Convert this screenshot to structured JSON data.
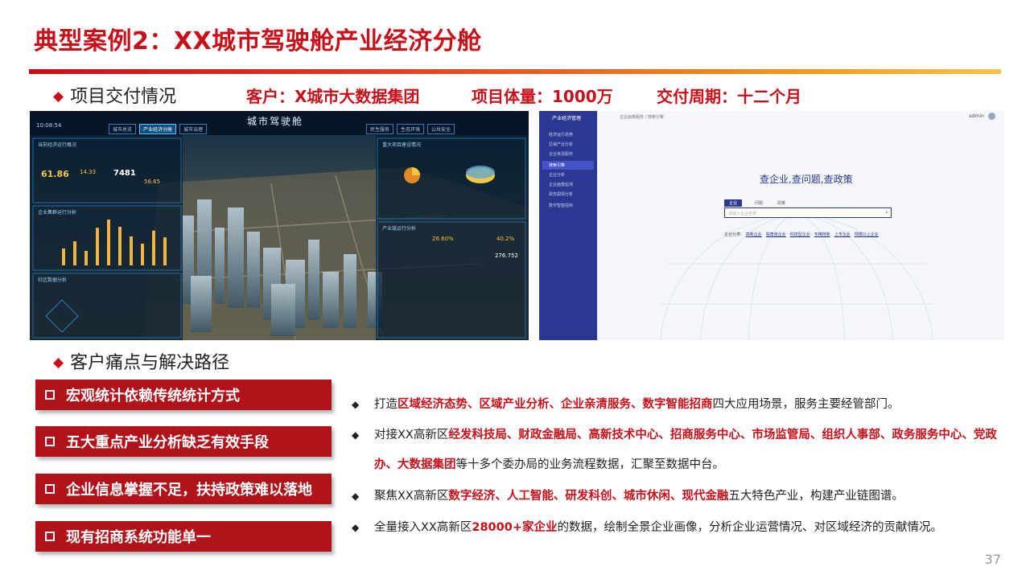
{
  "title": "典型案例2：XX城市驾驶舱产业经济分舱",
  "sections": {
    "delivery": "项目交付情况",
    "painpoints": "客户痛点与解决路径"
  },
  "metrics": [
    "客户：X城市大数据集团",
    "项目体量：1000万",
    "交付周期：十二个月"
  ],
  "dashboard": {
    "title": "城市驾驶舱",
    "time": "10:08:54",
    "tabs_left": [
      "城市总览",
      "产业经济分舱",
      "城市治理"
    ],
    "tabs_right": [
      "民生服务",
      "生态环境",
      "公共安全"
    ],
    "panel_tl": "当前经济运行概况",
    "panel_ml": "企业集群运行分析",
    "panel_bl": "社区数据分析",
    "panel_tr": "重大项目建设情况",
    "panel_mr": "产业链运行分析",
    "big_value": "61.86",
    "val_a": "7481",
    "val_b": "14.33",
    "val_c": "56.65",
    "val_d": "26.60%",
    "val_e": "40.2%",
    "val_f": "276.752",
    "bars": [
      0.35,
      0.5,
      0.3,
      0.78,
      0.95,
      0.8,
      0.6,
      0.45,
      0.72,
      0.58
    ]
  },
  "portal": {
    "brand": "产业经济管理",
    "user": "admin",
    "breadcrumb": "企业画像服务 / 搜索引擎",
    "slogan": "查企业,查问题,查政策",
    "tabs": [
      "企业",
      "问题",
      "政策"
    ],
    "search_placeholder": "请输入企业名称",
    "hot_label": "企业分类:",
    "hot_links": [
      "高新企业",
      "独角兽企业",
      "科技型企业",
      "专精特新",
      "上市企业",
      "规模以上企业"
    ],
    "sidebar": [
      "经济运行态势",
      "区域产业分析",
      "企业亲清服务",
      "搜索引擎",
      "企业分析",
      "企业画像监测",
      "政务舆情分析",
      "数字智能招商"
    ]
  },
  "pain_points": [
    "宏观统计依赖传统统计方式",
    "五大重点产业分析缺乏有效手段",
    "企业信息掌握不足，扶持政策难以落地",
    "现有招商系统功能单一"
  ],
  "bullets": [
    {
      "a": "打造",
      "h": "区域经济态势、区域产业分析、企业亲清服务、数字智能招商",
      "b": "四大应用场景，服务主要经管部门。"
    },
    {
      "a": "对接XX高新区",
      "h": "经发科技局、财政金融局、高新技术中心、招商服务中心、市场监管局、组织人事部、政务服务中心、党政办、大数据集团",
      "b": "等十多个委办局的业务流程数据，汇聚至数据中台。"
    },
    {
      "a": "聚焦XX高新区",
      "h": "数字经济、人工智能、研发科创、城市休闲、现代金融",
      "b": "五大特色产业，构建产业链图谱。"
    },
    {
      "a": "全量接入XX高新区",
      "h": "28000+家企业",
      "b": "的数据，绘制全景企业画像，分析企业运营情况、对区域经济的贡献情况。"
    }
  ],
  "page_number": "37"
}
